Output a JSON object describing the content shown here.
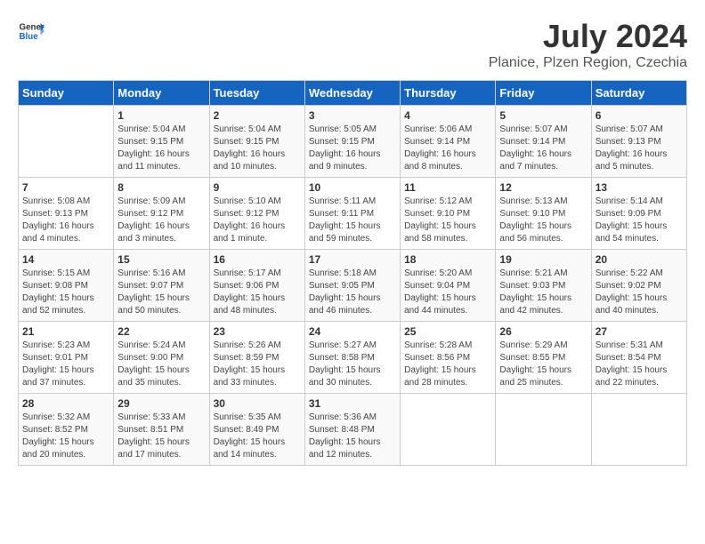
{
  "header": {
    "logo_general": "General",
    "logo_blue": "Blue",
    "month_year": "July 2024",
    "location": "Planice, Plzen Region, Czechia"
  },
  "weekdays": [
    "Sunday",
    "Monday",
    "Tuesday",
    "Wednesday",
    "Thursday",
    "Friday",
    "Saturday"
  ],
  "weeks": [
    [
      {
        "day": "",
        "sunrise": "",
        "sunset": "",
        "daylight": ""
      },
      {
        "day": "1",
        "sunrise": "Sunrise: 5:04 AM",
        "sunset": "Sunset: 9:15 PM",
        "daylight": "Daylight: 16 hours and 11 minutes."
      },
      {
        "day": "2",
        "sunrise": "Sunrise: 5:04 AM",
        "sunset": "Sunset: 9:15 PM",
        "daylight": "Daylight: 16 hours and 10 minutes."
      },
      {
        "day": "3",
        "sunrise": "Sunrise: 5:05 AM",
        "sunset": "Sunset: 9:15 PM",
        "daylight": "Daylight: 16 hours and 9 minutes."
      },
      {
        "day": "4",
        "sunrise": "Sunrise: 5:06 AM",
        "sunset": "Sunset: 9:14 PM",
        "daylight": "Daylight: 16 hours and 8 minutes."
      },
      {
        "day": "5",
        "sunrise": "Sunrise: 5:07 AM",
        "sunset": "Sunset: 9:14 PM",
        "daylight": "Daylight: 16 hours and 7 minutes."
      },
      {
        "day": "6",
        "sunrise": "Sunrise: 5:07 AM",
        "sunset": "Sunset: 9:13 PM",
        "daylight": "Daylight: 16 hours and 5 minutes."
      }
    ],
    [
      {
        "day": "7",
        "sunrise": "Sunrise: 5:08 AM",
        "sunset": "Sunset: 9:13 PM",
        "daylight": "Daylight: 16 hours and 4 minutes."
      },
      {
        "day": "8",
        "sunrise": "Sunrise: 5:09 AM",
        "sunset": "Sunset: 9:12 PM",
        "daylight": "Daylight: 16 hours and 3 minutes."
      },
      {
        "day": "9",
        "sunrise": "Sunrise: 5:10 AM",
        "sunset": "Sunset: 9:12 PM",
        "daylight": "Daylight: 16 hours and 1 minute."
      },
      {
        "day": "10",
        "sunrise": "Sunrise: 5:11 AM",
        "sunset": "Sunset: 9:11 PM",
        "daylight": "Daylight: 15 hours and 59 minutes."
      },
      {
        "day": "11",
        "sunrise": "Sunrise: 5:12 AM",
        "sunset": "Sunset: 9:10 PM",
        "daylight": "Daylight: 15 hours and 58 minutes."
      },
      {
        "day": "12",
        "sunrise": "Sunrise: 5:13 AM",
        "sunset": "Sunset: 9:10 PM",
        "daylight": "Daylight: 15 hours and 56 minutes."
      },
      {
        "day": "13",
        "sunrise": "Sunrise: 5:14 AM",
        "sunset": "Sunset: 9:09 PM",
        "daylight": "Daylight: 15 hours and 54 minutes."
      }
    ],
    [
      {
        "day": "14",
        "sunrise": "Sunrise: 5:15 AM",
        "sunset": "Sunset: 9:08 PM",
        "daylight": "Daylight: 15 hours and 52 minutes."
      },
      {
        "day": "15",
        "sunrise": "Sunrise: 5:16 AM",
        "sunset": "Sunset: 9:07 PM",
        "daylight": "Daylight: 15 hours and 50 minutes."
      },
      {
        "day": "16",
        "sunrise": "Sunrise: 5:17 AM",
        "sunset": "Sunset: 9:06 PM",
        "daylight": "Daylight: 15 hours and 48 minutes."
      },
      {
        "day": "17",
        "sunrise": "Sunrise: 5:18 AM",
        "sunset": "Sunset: 9:05 PM",
        "daylight": "Daylight: 15 hours and 46 minutes."
      },
      {
        "day": "18",
        "sunrise": "Sunrise: 5:20 AM",
        "sunset": "Sunset: 9:04 PM",
        "daylight": "Daylight: 15 hours and 44 minutes."
      },
      {
        "day": "19",
        "sunrise": "Sunrise: 5:21 AM",
        "sunset": "Sunset: 9:03 PM",
        "daylight": "Daylight: 15 hours and 42 minutes."
      },
      {
        "day": "20",
        "sunrise": "Sunrise: 5:22 AM",
        "sunset": "Sunset: 9:02 PM",
        "daylight": "Daylight: 15 hours and 40 minutes."
      }
    ],
    [
      {
        "day": "21",
        "sunrise": "Sunrise: 5:23 AM",
        "sunset": "Sunset: 9:01 PM",
        "daylight": "Daylight: 15 hours and 37 minutes."
      },
      {
        "day": "22",
        "sunrise": "Sunrise: 5:24 AM",
        "sunset": "Sunset: 9:00 PM",
        "daylight": "Daylight: 15 hours and 35 minutes."
      },
      {
        "day": "23",
        "sunrise": "Sunrise: 5:26 AM",
        "sunset": "Sunset: 8:59 PM",
        "daylight": "Daylight: 15 hours and 33 minutes."
      },
      {
        "day": "24",
        "sunrise": "Sunrise: 5:27 AM",
        "sunset": "Sunset: 8:58 PM",
        "daylight": "Daylight: 15 hours and 30 minutes."
      },
      {
        "day": "25",
        "sunrise": "Sunrise: 5:28 AM",
        "sunset": "Sunset: 8:56 PM",
        "daylight": "Daylight: 15 hours and 28 minutes."
      },
      {
        "day": "26",
        "sunrise": "Sunrise: 5:29 AM",
        "sunset": "Sunset: 8:55 PM",
        "daylight": "Daylight: 15 hours and 25 minutes."
      },
      {
        "day": "27",
        "sunrise": "Sunrise: 5:31 AM",
        "sunset": "Sunset: 8:54 PM",
        "daylight": "Daylight: 15 hours and 22 minutes."
      }
    ],
    [
      {
        "day": "28",
        "sunrise": "Sunrise: 5:32 AM",
        "sunset": "Sunset: 8:52 PM",
        "daylight": "Daylight: 15 hours and 20 minutes."
      },
      {
        "day": "29",
        "sunrise": "Sunrise: 5:33 AM",
        "sunset": "Sunset: 8:51 PM",
        "daylight": "Daylight: 15 hours and 17 minutes."
      },
      {
        "day": "30",
        "sunrise": "Sunrise: 5:35 AM",
        "sunset": "Sunset: 8:49 PM",
        "daylight": "Daylight: 15 hours and 14 minutes."
      },
      {
        "day": "31",
        "sunrise": "Sunrise: 5:36 AM",
        "sunset": "Sunset: 8:48 PM",
        "daylight": "Daylight: 15 hours and 12 minutes."
      },
      {
        "day": "",
        "sunrise": "",
        "sunset": "",
        "daylight": ""
      },
      {
        "day": "",
        "sunrise": "",
        "sunset": "",
        "daylight": ""
      },
      {
        "day": "",
        "sunrise": "",
        "sunset": "",
        "daylight": ""
      }
    ]
  ]
}
